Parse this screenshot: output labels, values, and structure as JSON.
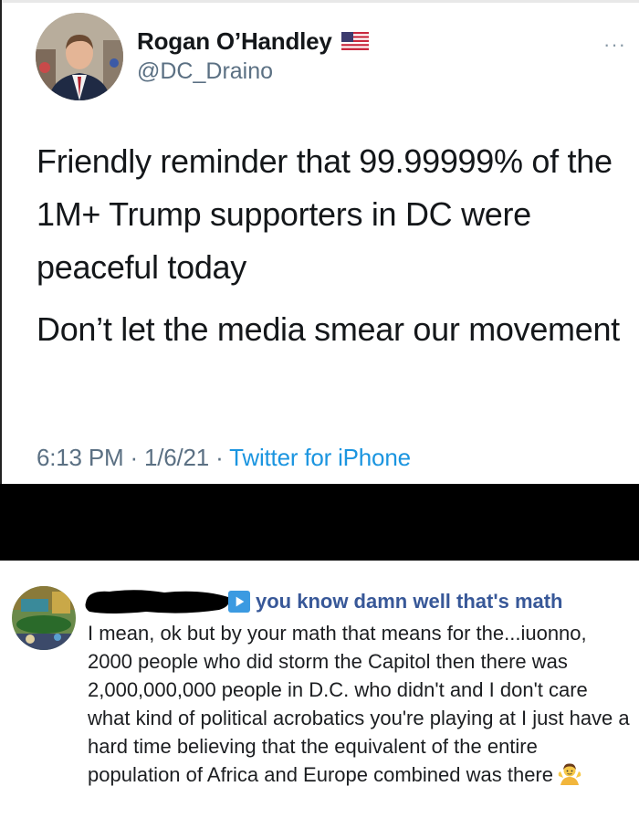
{
  "tweet": {
    "display_name": "Rogan O’Handley",
    "handle": "@DC_Draino",
    "flag_icon": "us-flag-icon",
    "more_icon": "···",
    "text_paragraphs": [
      "Friendly reminder that 99.99999% of the 1M+ Trump supporters in DC were peaceful today",
      "Don’t let the media smear our movement"
    ],
    "time": "6:13 PM",
    "sep1": "·",
    "date": "1/6/21",
    "sep2": "·",
    "source": "Twitter for iPhone",
    "colors": {
      "name": "#14171a",
      "handle": "#5b7083",
      "link": "#1b95e0"
    }
  },
  "comment": {
    "reply_icon": "play-button-icon",
    "reply_text": "you know damn well that's math",
    "body": "I mean, ok but by your math that means for the...iuonno, 2000 people who did storm the Capitol then there was 2,000,000,000 people in D.C. who didn't and I don't care what kind of political acrobatics you're playing at I just have a hard time believing that the equivalent of the entire population of Africa and Europe combined was there",
    "emoji": "person-shrugging-emoji",
    "colors": {
      "reply": "#385898",
      "body": "#1c1e21"
    }
  }
}
